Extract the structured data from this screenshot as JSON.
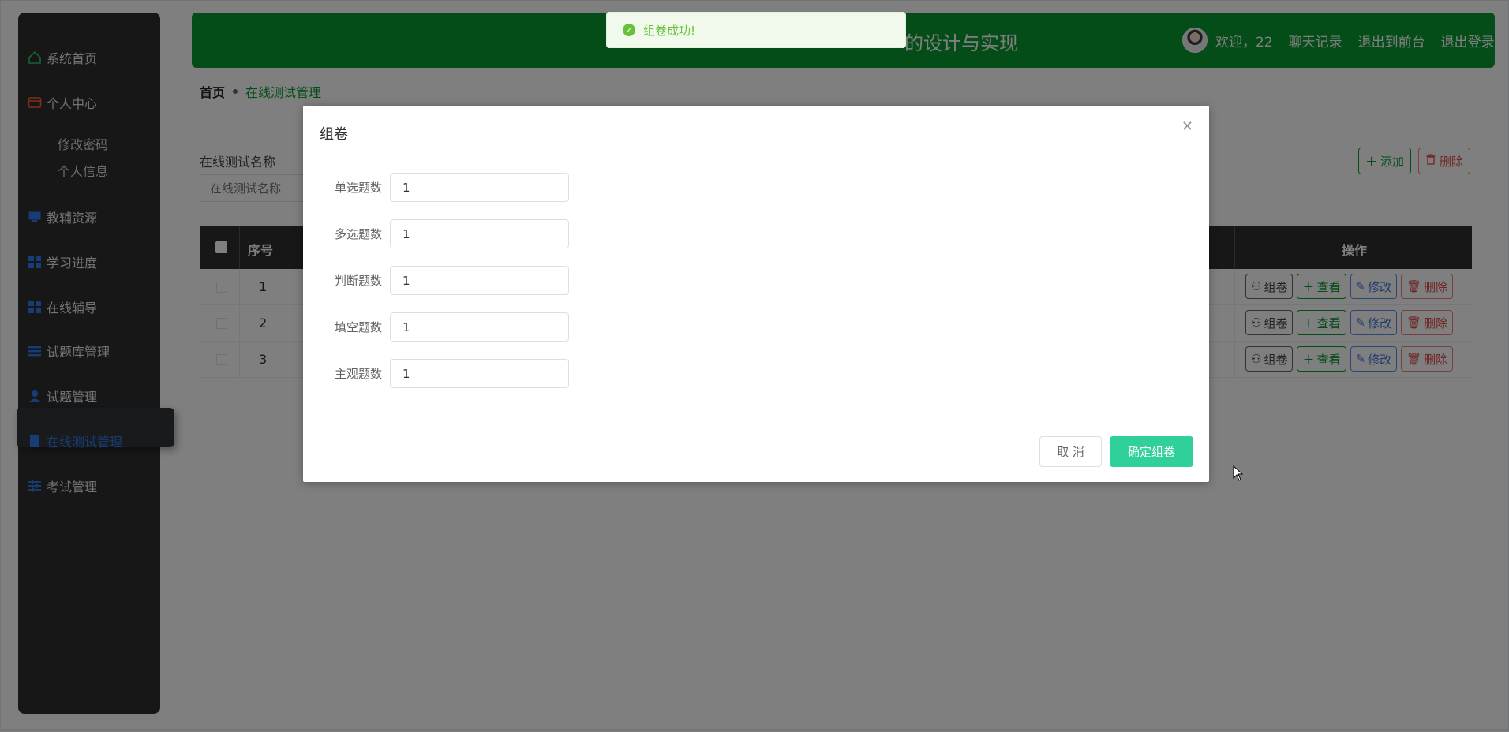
{
  "sidebar": {
    "items": [
      {
        "label": "系统首页",
        "icon": "home-icon"
      },
      {
        "label": "个人中心",
        "icon": "wallet-icon"
      },
      {
        "label": "修改密码"
      },
      {
        "label": "个人信息"
      },
      {
        "label": "教辅资源",
        "icon": "monitor-icon"
      },
      {
        "label": "学习进度",
        "icon": "grid-icon"
      },
      {
        "label": "在线辅导",
        "icon": "grid-icon"
      },
      {
        "label": "试题库管理",
        "icon": "list-icon"
      },
      {
        "label": "试题管理",
        "icon": "user-icon"
      },
      {
        "label": "在线测试管理",
        "icon": "doc-icon"
      },
      {
        "label": "考试管理",
        "icon": "sliders-icon"
      }
    ]
  },
  "header": {
    "title_fragment": "的设计与实现",
    "welcome": "欢迎，22",
    "chat_log": "聊天记录",
    "exit_front": "退出到前台",
    "logout": "退出登录"
  },
  "breadcrumb": {
    "home": "首页",
    "current": "在线测试管理"
  },
  "search": {
    "label": "在线测试名称",
    "placeholder": "在线测试名称"
  },
  "toolbar": {
    "add_label": "添加",
    "delete_label": "删除"
  },
  "table": {
    "headers": {
      "index": "序号",
      "ops": "操作"
    },
    "rows": [
      {
        "index": "1"
      },
      {
        "index": "2"
      },
      {
        "index": "3"
      }
    ],
    "op_labels": {
      "compose": "组卷",
      "view": "查看",
      "edit": "修改",
      "delete": "删除"
    }
  },
  "toast": {
    "message": "组卷成功!"
  },
  "dialog": {
    "title": "组卷",
    "fields": [
      {
        "label": "单选题数",
        "value": "1"
      },
      {
        "label": "多选题数",
        "value": "1"
      },
      {
        "label": "判断题数",
        "value": "1"
      },
      {
        "label": "填空题数",
        "value": "1"
      },
      {
        "label": "主观题数",
        "value": "1"
      }
    ],
    "cancel_label": "取 消",
    "confirm_label": "确定组卷"
  },
  "colors": {
    "brand_green": "#0b9b30",
    "sidebar_bg": "#2e2f31",
    "confirm_btn": "#2fd09a",
    "toast_text": "#67c23a"
  }
}
